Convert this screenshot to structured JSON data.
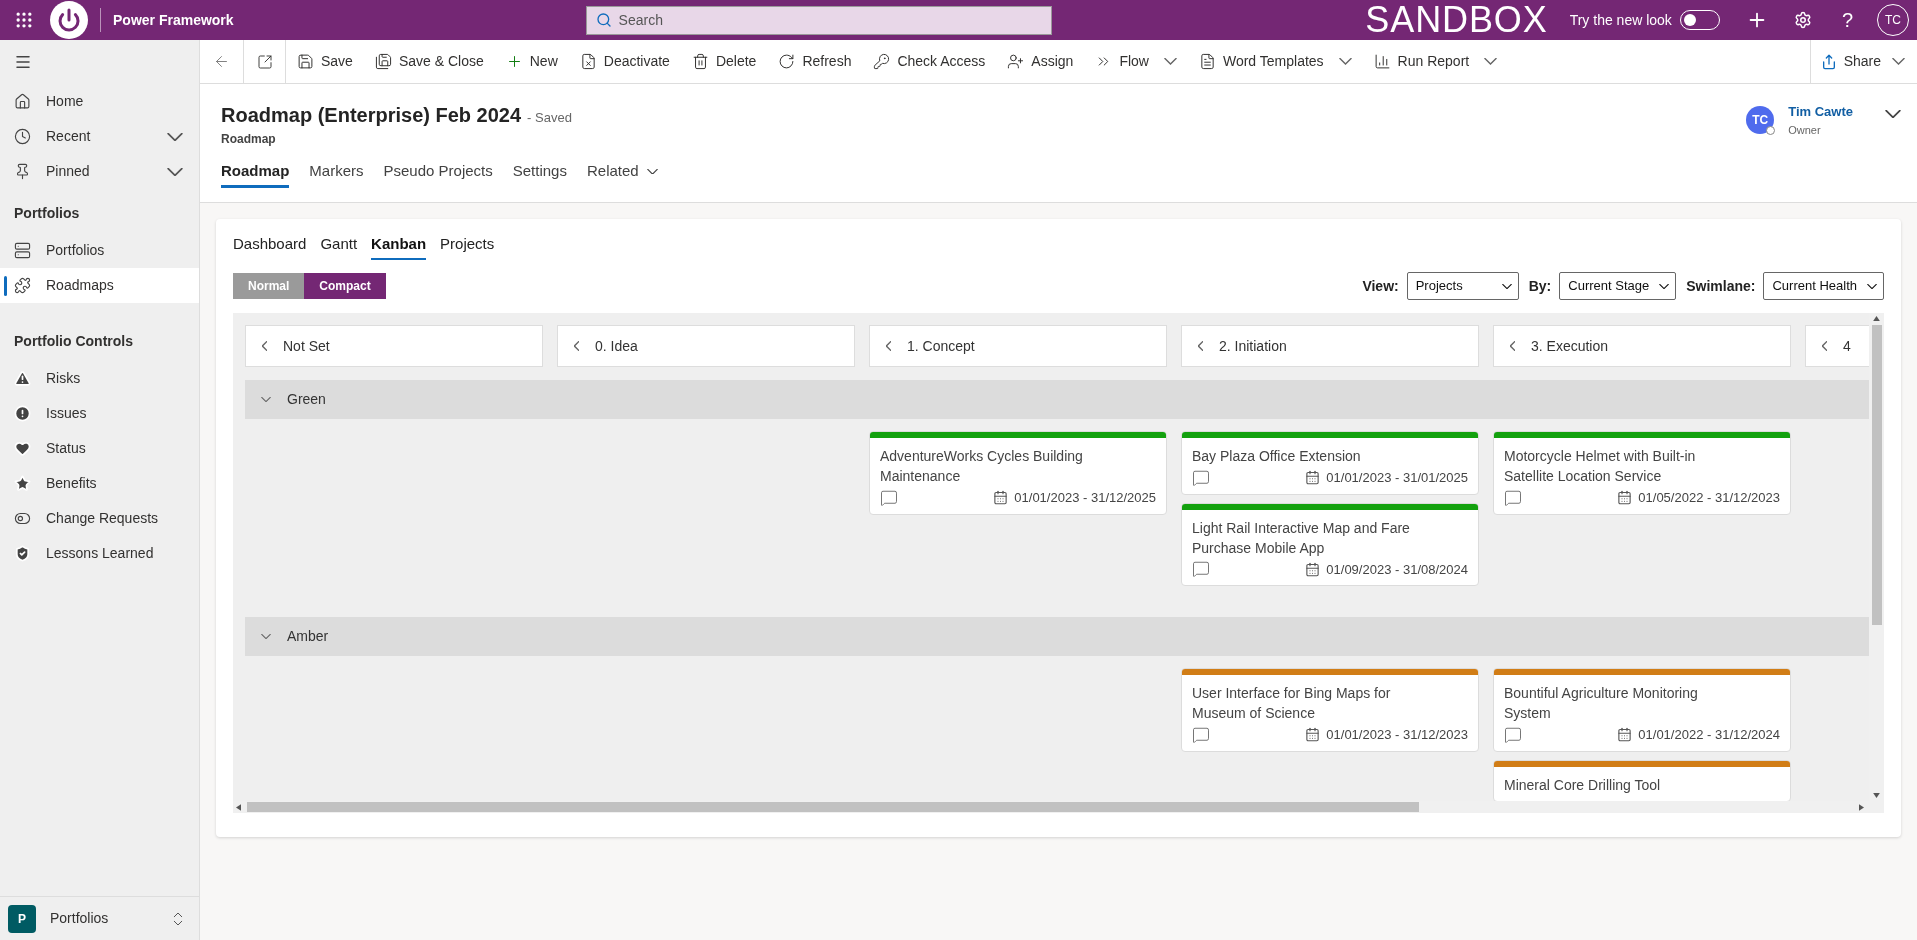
{
  "top_bar": {
    "app_name": "Power Framework",
    "search_placeholder": "Search",
    "environment": "SANDBOX",
    "new_look": {
      "label": "Try the new look",
      "on": false
    },
    "help_glyph": "?",
    "avatar_initials": "TC"
  },
  "command_bar": {
    "items": [
      {
        "label": "Save",
        "dropdown": false
      },
      {
        "label": "Save & Close",
        "dropdown": false
      },
      {
        "label": "New",
        "dropdown": false
      },
      {
        "label": "Deactivate",
        "dropdown": false
      },
      {
        "label": "Delete",
        "dropdown": false
      },
      {
        "label": "Refresh",
        "dropdown": false
      },
      {
        "label": "Check Access",
        "dropdown": false
      },
      {
        "label": "Assign",
        "dropdown": false
      },
      {
        "label": "Flow",
        "dropdown": true
      },
      {
        "label": "Word Templates",
        "dropdown": true
      },
      {
        "label": "Run Report",
        "dropdown": true
      }
    ],
    "share": {
      "label": "Share"
    }
  },
  "record": {
    "title": "Roadmap (Enterprise) Feb 2024",
    "status": "- Saved",
    "entity": "Roadmap",
    "owner": {
      "initials": "TC",
      "name": "Tim Cawte",
      "role": "Owner"
    }
  },
  "form_tabs": [
    {
      "label": "Roadmap",
      "selected": true,
      "dropdown": false
    },
    {
      "label": "Markers",
      "selected": false,
      "dropdown": false
    },
    {
      "label": "Pseudo Projects",
      "selected": false,
      "dropdown": false
    },
    {
      "label": "Settings",
      "selected": false,
      "dropdown": false
    },
    {
      "label": "Related",
      "selected": false,
      "dropdown": true
    }
  ],
  "sidebar": {
    "top_items": [
      {
        "label": "Home",
        "expandable": false
      },
      {
        "label": "Recent",
        "expandable": true
      },
      {
        "label": "Pinned",
        "expandable": true
      }
    ],
    "sections": [
      {
        "title": "Portfolios",
        "items": [
          {
            "label": "Portfolios",
            "selected": false
          },
          {
            "label": "Roadmaps",
            "selected": true
          }
        ]
      },
      {
        "title": "Portfolio Controls",
        "items": [
          {
            "label": "Risks",
            "selected": false
          },
          {
            "label": "Issues",
            "selected": false
          },
          {
            "label": "Status",
            "selected": false
          },
          {
            "label": "Benefits",
            "selected": false
          },
          {
            "label": "Change Requests",
            "selected": false
          },
          {
            "label": "Lessons Learned",
            "selected": false
          }
        ]
      }
    ],
    "area": {
      "initial": "P",
      "label": "Portfolios"
    }
  },
  "kanban": {
    "view_tabs": [
      {
        "label": "Dashboard",
        "selected": false
      },
      {
        "label": "Gantt",
        "selected": false
      },
      {
        "label": "Kanban",
        "selected": true
      },
      {
        "label": "Projects",
        "selected": false
      }
    ],
    "density": [
      {
        "label": "Normal",
        "selected": false
      },
      {
        "label": "Compact",
        "selected": true
      }
    ],
    "filters": [
      {
        "label": "View:",
        "value": "Projects"
      },
      {
        "label": "By:",
        "value": "Current Stage"
      },
      {
        "label": "Swimlane:",
        "value": "Current Health"
      }
    ],
    "swimlanes": [
      {
        "name": "Green",
        "color": "#13a10e",
        "expanded": true
      },
      {
        "name": "Amber",
        "color": "#d17d16",
        "expanded": true
      }
    ],
    "columns": [
      {
        "label": "Not Set"
      },
      {
        "label": "0. Idea"
      },
      {
        "label": "1. Concept",
        "lanes": [
          {
            "cards": [
              {
                "title": "AdventureWorks Cycles Building Maintenance",
                "dates": "01/01/2023 - 31/12/2025"
              }
            ]
          }
        ]
      },
      {
        "label": "2. Initiation",
        "lanes": [
          {
            "cards": [
              {
                "title": "Bay Plaza Office Extension",
                "dates": "01/01/2023 - 31/01/2025"
              },
              {
                "title": "Light Rail Interactive Map and Fare Purchase Mobile App",
                "dates": "01/09/2023 - 31/08/2024"
              }
            ]
          },
          {
            "cards": [
              {
                "title": "User Interface for Bing Maps for Museum of Science",
                "dates": "01/01/2023 - 31/12/2023"
              }
            ]
          }
        ]
      },
      {
        "label": "3. Execution",
        "lanes": [
          {
            "cards": [
              {
                "title": "Motorcycle Helmet with Built-in Satellite Location Service",
                "dates": "01/05/2022 - 31/12/2023"
              }
            ]
          },
          {
            "cards": [
              {
                "title": "Bountiful Agriculture Monitoring System",
                "dates": "01/01/2022 - 31/12/2024"
              },
              {
                "title": "Mineral Core Drilling Tool"
              }
            ]
          }
        ]
      },
      {
        "label": "4"
      }
    ]
  }
}
